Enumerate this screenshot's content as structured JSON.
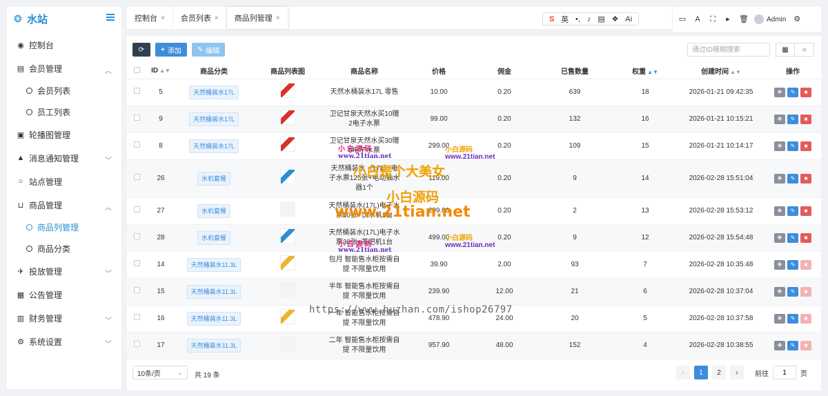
{
  "app": {
    "logo_text": "水站"
  },
  "sidebar": {
    "items": [
      {
        "label": "控制台",
        "icon": "dashboard-icon",
        "glyph": "◉"
      },
      {
        "label": "会员管理",
        "icon": "id-card-icon",
        "glyph": "▤",
        "expanded": true,
        "children": [
          {
            "label": "会员列表"
          },
          {
            "label": "员工列表"
          }
        ]
      },
      {
        "label": "轮播图管理",
        "icon": "image-icon",
        "glyph": "▣"
      },
      {
        "label": "消息通知管理",
        "icon": "bell-icon",
        "glyph": "▲"
      },
      {
        "label": "站点管理",
        "icon": "circle-icon",
        "glyph": "○"
      },
      {
        "label": "商品管理",
        "icon": "cart-icon",
        "glyph": "⊔",
        "expanded": true,
        "children": [
          {
            "label": "商品列管理",
            "active": true
          },
          {
            "label": "商品分类"
          }
        ]
      },
      {
        "label": "投放管理",
        "icon": "plane-icon",
        "glyph": "✈"
      },
      {
        "label": "公告管理",
        "icon": "calendar-icon",
        "glyph": "▦"
      },
      {
        "label": "财务管理",
        "icon": "bar-chart-icon",
        "glyph": "▥"
      },
      {
        "label": "系统设置",
        "icon": "gear-icon",
        "glyph": "⚙"
      }
    ]
  },
  "tabs": [
    {
      "label": "控制台",
      "close": "×"
    },
    {
      "label": "会员列表",
      "close": "×"
    },
    {
      "label": "商品列管理",
      "close": "×",
      "active": true
    }
  ],
  "ime": {
    "s": "S",
    "lang": "英",
    "items": [
      "•,",
      "♪",
      "▤",
      "❖",
      "Ai"
    ]
  },
  "header": {
    "admin_name": "Admin"
  },
  "toolbar": {
    "add_label": "添加",
    "edit_label": "编辑"
  },
  "search": {
    "placeholder": "通过ID模糊搜索"
  },
  "table": {
    "columns": [
      "",
      "ID",
      "商品分类",
      "商品列表图",
      "商品名称",
      "价格",
      "佣金",
      "已售数量",
      "权重",
      "创建时间",
      "操作"
    ],
    "rows": [
      {
        "id": "5",
        "category": "天然桶装水17L",
        "thumb": "red",
        "name": [
          "天然水桶装水17L 零售"
        ],
        "price": "10.00",
        "commission": "0.20",
        "sold": "639",
        "weight": "18",
        "created": "2026-01-21 09:42:35",
        "del_disabled": false
      },
      {
        "id": "9",
        "category": "天然桶装水17L",
        "thumb": "red",
        "name": [
          "卫记甘泉天然水买10赠",
          "2电子水票"
        ],
        "price": "99.00",
        "commission": "0.20",
        "sold": "132",
        "weight": "16",
        "created": "2026-01-21 10:15:21",
        "del_disabled": false
      },
      {
        "id": "8",
        "category": "天然桶装水17L",
        "thumb": "red",
        "name": [
          "卫记甘泉天然水买30赠",
          "5电子水票"
        ],
        "price": "299.00",
        "commission": "0.20",
        "sold": "109",
        "weight": "15",
        "created": "2026-01-21 10:14:17",
        "del_disabled": false
      },
      {
        "id": "26",
        "category": "水机套餐",
        "thumb": "blue",
        "name": [
          "天然桶装水（17L）电",
          "子水票125张+电动抽水",
          "器1个"
        ],
        "price": "119.00",
        "commission": "0.20",
        "sold": "9",
        "weight": "14",
        "created": "2026-02-28 15:51:04",
        "del_disabled": false
      },
      {
        "id": "27",
        "category": "水机套餐",
        "thumb": "empty",
        "name": [
          "天然桶装水(17L)电子水",
          "票20张+饮水机1台"
        ],
        "price": "299.00",
        "commission": "0.20",
        "sold": "2",
        "weight": "13",
        "created": "2026-02-28 15:53:12",
        "del_disabled": false
      },
      {
        "id": "28",
        "category": "水机套餐",
        "thumb": "blue",
        "name": [
          "天然桶装水(17L)电子水",
          "票30张+茶吧机1台"
        ],
        "price": "499.00",
        "commission": "0.20",
        "sold": "9",
        "weight": "12",
        "created": "2026-02-28 15:54:48",
        "del_disabled": false
      },
      {
        "id": "14",
        "category": "天然桶装水11.3L",
        "thumb": "yellow",
        "name": [
          "包月 智能售水柜按需自",
          "提 不限量饮用"
        ],
        "price": "39.90",
        "commission": "2.00",
        "sold": "93",
        "weight": "7",
        "created": "2026-02-28 10:35:48",
        "del_disabled": true
      },
      {
        "id": "15",
        "category": "天然桶装水11.3L",
        "thumb": "empty",
        "name": [
          "半年 智能售水柜按需自",
          "提 不限量饮用"
        ],
        "price": "239.90",
        "commission": "12.00",
        "sold": "21",
        "weight": "6",
        "created": "2026-02-28 10:37:04",
        "del_disabled": true
      },
      {
        "id": "16",
        "category": "天然桶装水11.3L",
        "thumb": "yellow",
        "name": [
          "一年 智能售水柜按需自",
          "提 不限量饮用"
        ],
        "price": "478.90",
        "commission": "24.00",
        "sold": "20",
        "weight": "5",
        "created": "2026-02-28 10:37:58",
        "del_disabled": true
      },
      {
        "id": "17",
        "category": "天然桶装水11.3L",
        "thumb": "empty",
        "name": [
          "二年 智能售水柜按需自",
          "提 不限量饮用"
        ],
        "price": "957.90",
        "commission": "48.00",
        "sold": "152",
        "weight": "4",
        "created": "2026-02-28 10:38:55",
        "del_disabled": true
      }
    ]
  },
  "pagination": {
    "page_size": "10条/页",
    "total": "共 19 条",
    "pages": [
      "1",
      "2"
    ],
    "current": "1",
    "goto_label": "前往",
    "goto_value": "1",
    "page_suffix": "页"
  },
  "watermarks": {
    "w1": "小 白 源 码",
    "w2": "www.21tian.net",
    "w3": "小白源码",
    "w4": "www.21tian.net",
    "w5": "小白是个大美女",
    "w6": "小白源码",
    "w7": "www.21tian.net",
    "w8": "小白源码",
    "w9": "www.21tian.net",
    "w10": "小 白 源 码",
    "w11": "www.21tian.net",
    "w12": "https://www.huzhan.com/ishop26797"
  },
  "colors": {
    "primary": "#3d8ddc",
    "danger": "#e45b5b",
    "dark": "#2f4050"
  }
}
